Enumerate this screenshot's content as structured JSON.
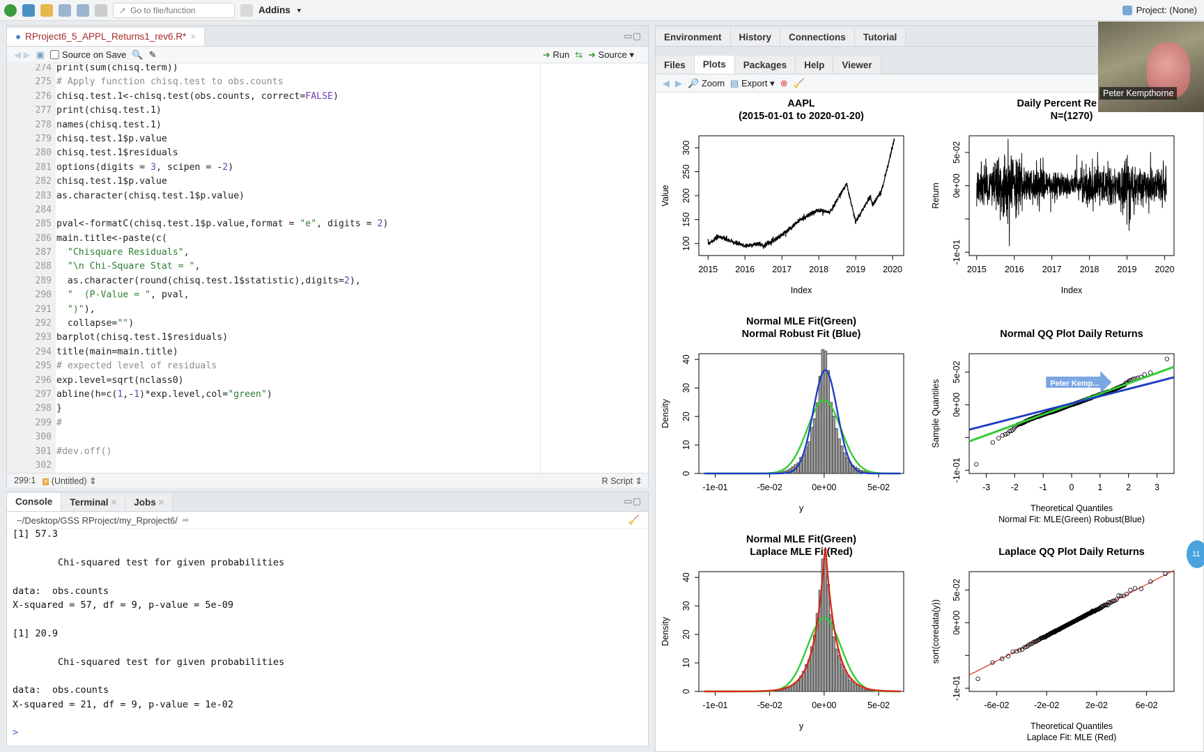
{
  "toolbar": {
    "goto_placeholder": "Go to file/function",
    "addins": "Addins",
    "project": "Project: (None)"
  },
  "editor": {
    "tab_title": "RProject6_5_APPL_Returns1_rev6.R*",
    "source_on_save": "Source on Save",
    "run": "Run",
    "source": "Source",
    "first_line": 274,
    "lines": [
      "print(sum(chisq.term))",
      "# Apply function chisq.test to obs.counts",
      "chisq.test.1<-chisq.test(obs.counts, correct=FALSE)",
      "print(chisq.test.1)",
      "names(chisq.test.1)",
      "chisq.test.1$p.value",
      "chisq.test.1$residuals",
      "options(digits = 3, scipen = -2)",
      "chisq.test.1$p.value",
      "as.character(chisq.test.1$p.value)",
      "",
      "pval<-formatC(chisq.test.1$p.value,format = \"e\", digits = 2)",
      "main.title<-paste(c(",
      "  \"Chisquare Residuals\",",
      "  \"\\n Chi-Square Stat = \",",
      "  as.character(round(chisq.test.1$statistic),digits=2),",
      "  \"  (P-Value = \", pval,",
      "  \")\"),",
      "  collapse=\"\")",
      "barplot(chisq.test.1$residuals)",
      "title(main=main.title)",
      "# expected level of residuals",
      "exp.level=sqrt(nclass0)",
      "abline(h=c(1,-1)*exp.level,col=\"green\")",
      "}",
      "#",
      "",
      "#dev.off()",
      ""
    ],
    "status_pos": "299:1",
    "status_scope": "(Untitled)",
    "status_type": "R Script"
  },
  "console": {
    "tabs": [
      "Console",
      "Terminal",
      "Jobs"
    ],
    "path": "~/Desktop/GSS RProject/my_Rproject6/",
    "lines": [
      "[1] 57.3",
      "",
      "        Chi-squared test for given probabilities",
      "",
      "data:  obs.counts",
      "X-squared = 57, df = 9, p-value = 5e-09",
      "",
      "[1] 20.9",
      "",
      "        Chi-squared test for given probabilities",
      "",
      "data:  obs.counts",
      "X-squared = 21, df = 9, p-value = 1e-02",
      "",
      ">"
    ]
  },
  "right": {
    "tabs_top": [
      "Environment",
      "History",
      "Connections",
      "Tutorial"
    ],
    "tabs_bottom": [
      "Files",
      "Plots",
      "Packages",
      "Help",
      "Viewer"
    ],
    "zoom": "Zoom",
    "export": "Export"
  },
  "video": {
    "name": "Peter Kempthorne",
    "annotation": "Peter Kemp..."
  },
  "plots": [
    {
      "title": [
        "AAPL",
        "(2015-01-01 to 2020-01-20)"
      ],
      "xlabel": "Index",
      "ylabel": "Value",
      "xticks": [
        "2015",
        "2016",
        "2017",
        "2018",
        "2019",
        "2020"
      ],
      "yticks": [
        "100",
        "150",
        "200",
        "250",
        "300"
      ]
    },
    {
      "title": [
        "Daily Percent Re",
        "N=(1270)"
      ],
      "xlabel": "Index",
      "ylabel": "Return",
      "xticks": [
        "2015",
        "2016",
        "2017",
        "2018",
        "2019",
        "2020"
      ],
      "yticks": [
        "-1e-01",
        "0e+00",
        "5e-02"
      ]
    },
    {
      "title": [
        "Normal MLE Fit(Green)",
        "Normal Robust Fit (Blue)"
      ],
      "xlabel": "y",
      "ylabel": "Density",
      "xticks": [
        "-1e-01",
        "-5e-02",
        "0e+00",
        "5e-02"
      ],
      "yticks": [
        "0",
        "10",
        "20",
        "30",
        "40"
      ]
    },
    {
      "title": [
        "Normal QQ Plot Daily Returns"
      ],
      "xlabel": "Theoretical Quantiles",
      "sub": "Normal Fit: MLE(Green) Robust(Blue)",
      "ylabel": "Sample Quantiles",
      "xticks": [
        "-3",
        "-2",
        "-1",
        "0",
        "1",
        "2",
        "3"
      ],
      "yticks": [
        "-1e-01",
        "0e+00",
        "5e-02"
      ]
    },
    {
      "title": [
        "Normal MLE Fit(Green)",
        "Laplace MLE Fit(Red)"
      ],
      "xlabel": "y",
      "ylabel": "Density",
      "xticks": [
        "-1e-01",
        "-5e-02",
        "0e+00",
        "5e-02"
      ],
      "yticks": [
        "0",
        "10",
        "20",
        "30",
        "40"
      ]
    },
    {
      "title": [
        "Laplace QQ Plot Daily Returns"
      ],
      "xlabel": "Theoretical Quantiles",
      "sub": "Laplace Fit: MLE (Red)",
      "ylabel": "sort(coredata(y))",
      "xticks": [
        "-6e-02",
        "-2e-02",
        "2e-02",
        "6e-02"
      ],
      "yticks": [
        "-1e-01",
        "0e+00",
        "5e-02"
      ]
    }
  ],
  "colors": {
    "mle": "#33cc33",
    "robust": "#1f3fbf",
    "laplace": "#d62a1e",
    "accent": "#8a1b1b"
  }
}
